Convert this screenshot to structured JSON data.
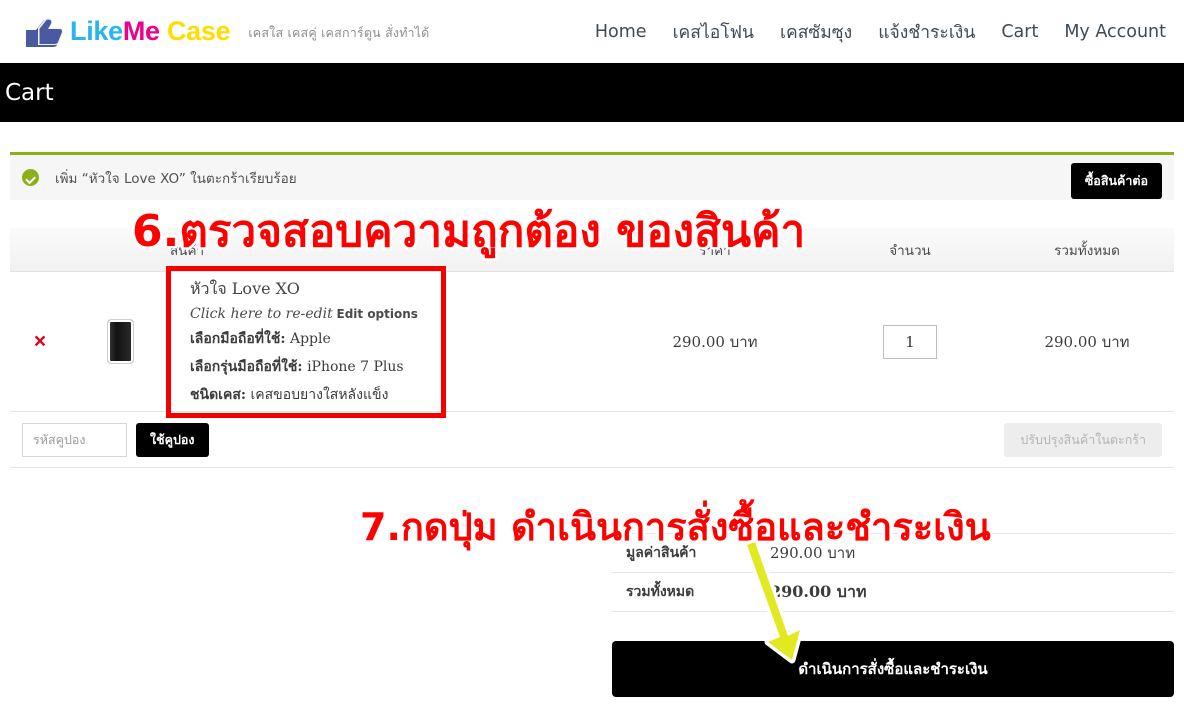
{
  "header": {
    "brand": {
      "part1": "Like",
      "part2": "Me",
      "part3": "Case",
      "color1": "#29b6e8",
      "color2": "#ec008c",
      "color3": "#ffdd00"
    },
    "tagline": "เคสใส เคสคู่ เคสการ์ตูน สั่งทำได้",
    "nav": [
      {
        "label": "Home"
      },
      {
        "label": "เคสไอโฟน"
      },
      {
        "label": "เคสซัมซุง"
      },
      {
        "label": "แจ้งชำระเงิน"
      },
      {
        "label": "Cart"
      },
      {
        "label": "My Account"
      }
    ]
  },
  "page_title": "Cart",
  "notice": {
    "message": "เพิ่ม “หัวใจ Love XO” ในตะกร้าเรียบร้อย",
    "continue_label": "ซื้อสินค้าต่อ",
    "accent_color": "#8fae1b"
  },
  "cart_table": {
    "headers": {
      "product": "สินค้า",
      "price": "ราคา",
      "quantity": "จำนวน",
      "total": "รวมทั้งหมด"
    },
    "rows": [
      {
        "remove_label": "×",
        "name": "หัวใจ Love XO",
        "edit_link": "Click here to re-edit",
        "edit_options": "Edit options",
        "attributes": [
          {
            "label": "เลือกมือถือที่ใช้:",
            "value": "Apple"
          },
          {
            "label": "เลือกรุ่นมือถือที่ใช้:",
            "value": "iPhone 7 Plus"
          },
          {
            "label": "ชนิดเคส:",
            "value": "เคสขอบยางใสหลังแข็ง"
          }
        ],
        "price": "290.00 บาท",
        "quantity": "1",
        "line_total": "290.00 บาท"
      }
    ],
    "coupon_placeholder": "รหัสคูปอง",
    "coupon_button": "ใช้คูปอง",
    "update_button": "ปรับปรุงสินค้าในตะกร้า"
  },
  "totals": {
    "rows": [
      {
        "label": "มูลค่าสินค้า",
        "value": "290.00 บาท",
        "strong": false
      },
      {
        "label": "รวมทั้งหมด",
        "value": "290.00 บาท",
        "strong": true
      }
    ],
    "checkout_label": "ดำเนินการสั่งซื้อและชำระเงิน"
  },
  "annotations": {
    "step6": "6.ตรวจสอบความถูกต้อง ของสินค้า",
    "step7": "7.กดปุ่ม ดำเนินการสั่งซื้อและชำระเงิน",
    "highlight_color": "#f40000",
    "arrow_color": "#e2e822"
  }
}
